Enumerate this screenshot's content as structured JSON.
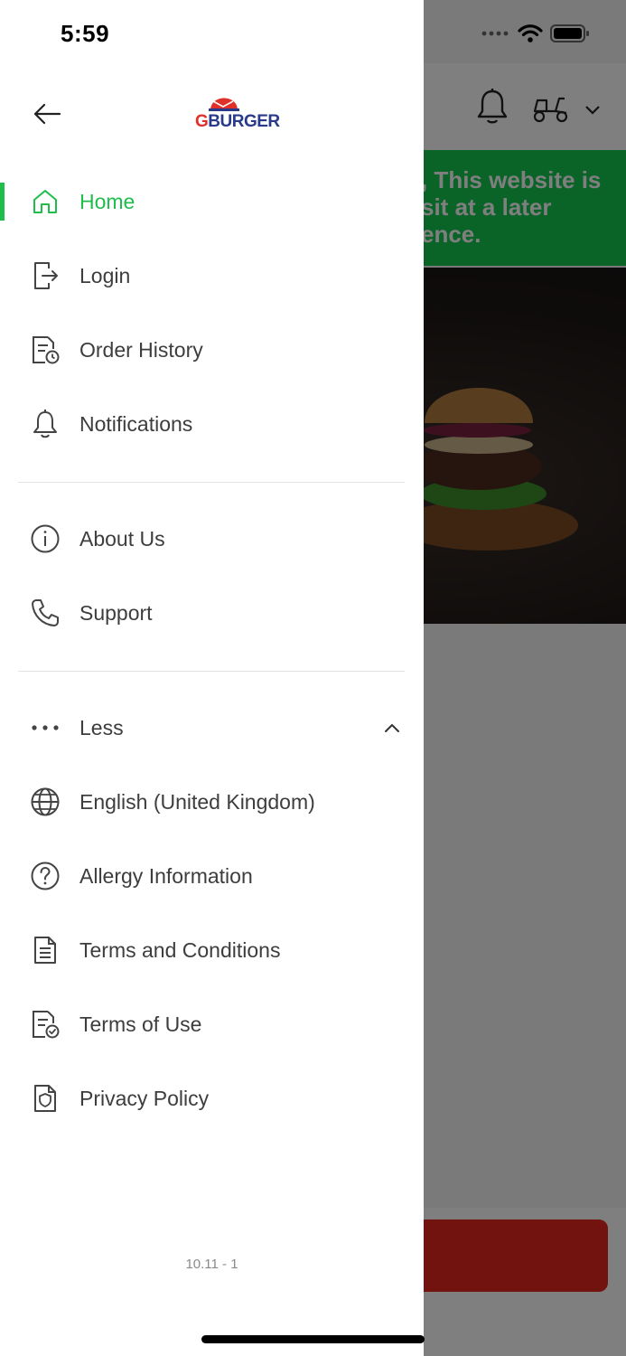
{
  "status_bar": {
    "time": "5:59"
  },
  "background": {
    "banner_lines": [
      ", This website is",
      "sit at a later",
      "ence."
    ],
    "banner_color": "#14c850",
    "cta_color": "#e4261f"
  },
  "brand": {
    "logo_prefix": "G",
    "logo_suffix": "BURGER"
  },
  "menu": {
    "accent_color": "#1fbd4c",
    "primary": [
      {
        "label": "Home",
        "icon": "home-icon",
        "active": true
      },
      {
        "label": "Login",
        "icon": "login-icon"
      },
      {
        "label": "Order History",
        "icon": "order-history-icon"
      },
      {
        "label": "Notifications",
        "icon": "bell-icon"
      }
    ],
    "secondary": [
      {
        "label": "About Us",
        "icon": "info-icon"
      },
      {
        "label": "Support",
        "icon": "phone-icon"
      }
    ],
    "less_label": "Less",
    "more": [
      {
        "label": "English (United Kingdom)",
        "icon": "globe-icon"
      },
      {
        "label": "Allergy Information",
        "icon": "help-circle-icon"
      },
      {
        "label": "Terms and Conditions",
        "icon": "document-icon"
      },
      {
        "label": "Terms of Use",
        "icon": "document-check-icon"
      },
      {
        "label": "Privacy Policy",
        "icon": "privacy-shield-icon"
      }
    ]
  },
  "version": "10.11 - 1"
}
